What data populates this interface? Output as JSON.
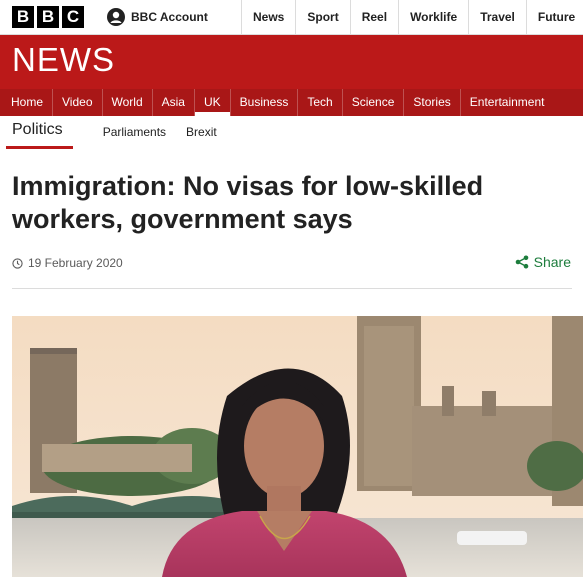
{
  "brand": {
    "letters": [
      "B",
      "B",
      "C"
    ]
  },
  "account": {
    "label": "BBC Account",
    "icon": "user-icon"
  },
  "top_nav": [
    "News",
    "Sport",
    "Reel",
    "Worklife",
    "Travel",
    "Future"
  ],
  "section": {
    "title": "NEWS"
  },
  "news_nav": {
    "items": [
      "Home",
      "Video",
      "World",
      "Asia",
      "UK",
      "Business",
      "Tech",
      "Science",
      "Stories",
      "Entertainment"
    ],
    "active": "UK"
  },
  "sub_nav": {
    "active": "Politics",
    "items": [
      "Parliaments",
      "Brexit"
    ]
  },
  "article": {
    "headline": "Immigration: No visas for low-skilled workers, government says",
    "date": "19 February 2020",
    "share_label": "Share"
  },
  "icons": {
    "clock": "clock-icon",
    "share": "share-icon"
  },
  "colors": {
    "brand_red": "#bb1919",
    "nav_red": "#a91717",
    "share_green": "#1d7d3d"
  }
}
